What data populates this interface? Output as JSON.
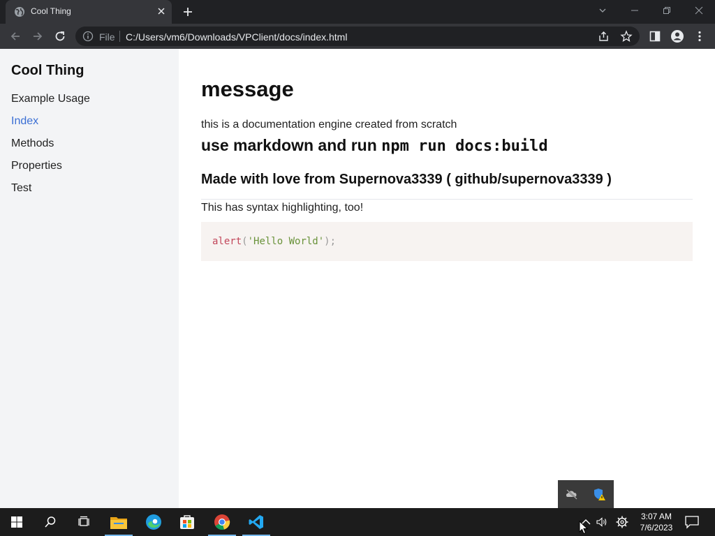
{
  "browser": {
    "tab_title": "Cool Thing",
    "scheme_label": "File",
    "url": "C:/Users/vm6/Downloads/VPClient/docs/index.html"
  },
  "sidebar": {
    "title": "Cool Thing",
    "items": [
      {
        "label": "Example Usage",
        "active": false
      },
      {
        "label": "Index",
        "active": true
      },
      {
        "label": "Methods",
        "active": false
      },
      {
        "label": "Properties",
        "active": false
      },
      {
        "label": "Test",
        "active": false
      }
    ]
  },
  "content": {
    "heading": "message",
    "intro": "this is a documentation engine created from scratch",
    "h2_text": "use markdown and run ",
    "h2_code": "npm run docs:build",
    "h3": "Made with love from Supernova3339 ( github/supernova3339 )",
    "syntax_note": "This has syntax highlighting, too!",
    "code": {
      "fn": "alert",
      "open": "(",
      "string": "'Hello World'",
      "close": ");"
    }
  },
  "taskbar": {
    "apps": [
      "start-icon",
      "search-icon",
      "task-view-icon",
      "file-explorer-icon",
      "edge-icon",
      "store-icon",
      "chrome-icon",
      "vscode-icon"
    ],
    "time": "3:07 AM",
    "date": "7/6/2023"
  },
  "colors": {
    "link_active": "#3b6fd4",
    "sidebar_bg": "#f3f4f6",
    "code_bg": "#f7f3f1",
    "code_fn": "#c2475b",
    "code_string": "#69923a"
  }
}
